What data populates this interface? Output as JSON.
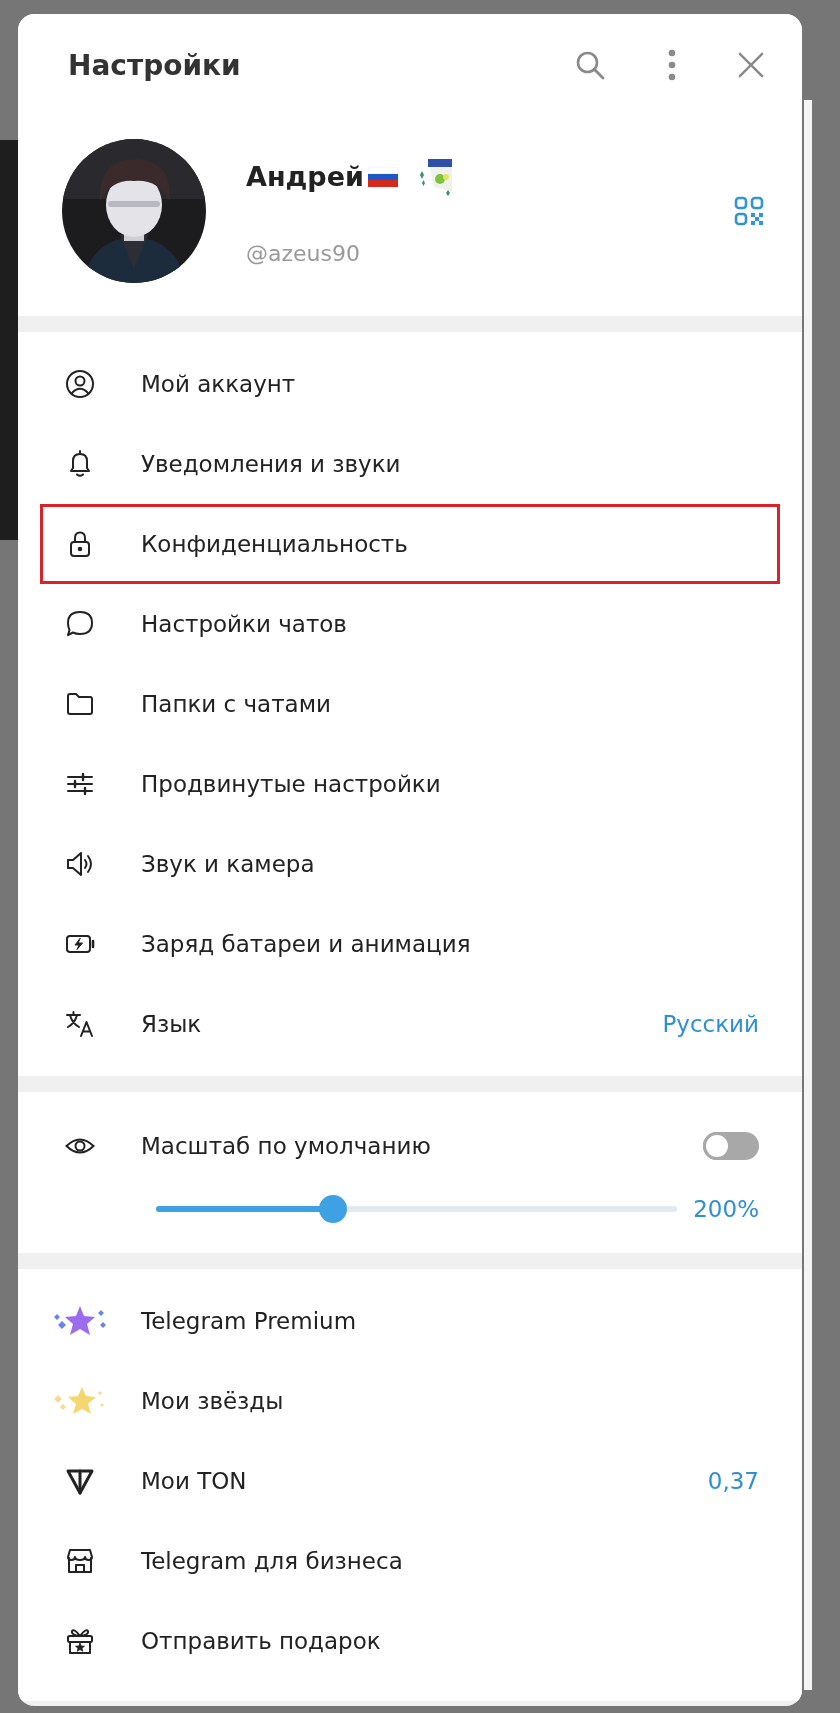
{
  "dialog": {
    "title": "Настройки"
  },
  "profile": {
    "name": "Андрей",
    "username": "@azeus90"
  },
  "menu": [
    {
      "label": "Мой аккаунт",
      "highlighted": false
    },
    {
      "label": "Уведомления и звуки",
      "highlighted": false
    },
    {
      "label": "Конфиденциальность",
      "highlighted": true
    },
    {
      "label": "Настройки чатов",
      "highlighted": false
    },
    {
      "label": "Папки с чатами",
      "highlighted": false
    },
    {
      "label": "Продвинутые настройки",
      "highlighted": false
    },
    {
      "label": "Звук и камера",
      "highlighted": false
    },
    {
      "label": "Заряд батареи и анимация",
      "highlighted": false
    },
    {
      "label": "Язык",
      "value": "Русский",
      "highlighted": false
    }
  ],
  "zoom": {
    "label": "Масштаб по умолчанию",
    "on": false,
    "level": 0.34,
    "reading": "200%"
  },
  "extras": [
    {
      "label": "Telegram Premium"
    },
    {
      "label": "Мои звёзды"
    },
    {
      "label": "Мои TON",
      "value": "0,37"
    },
    {
      "label": "Telegram для бизнеса"
    },
    {
      "label": "Отправить подарок"
    }
  ]
}
